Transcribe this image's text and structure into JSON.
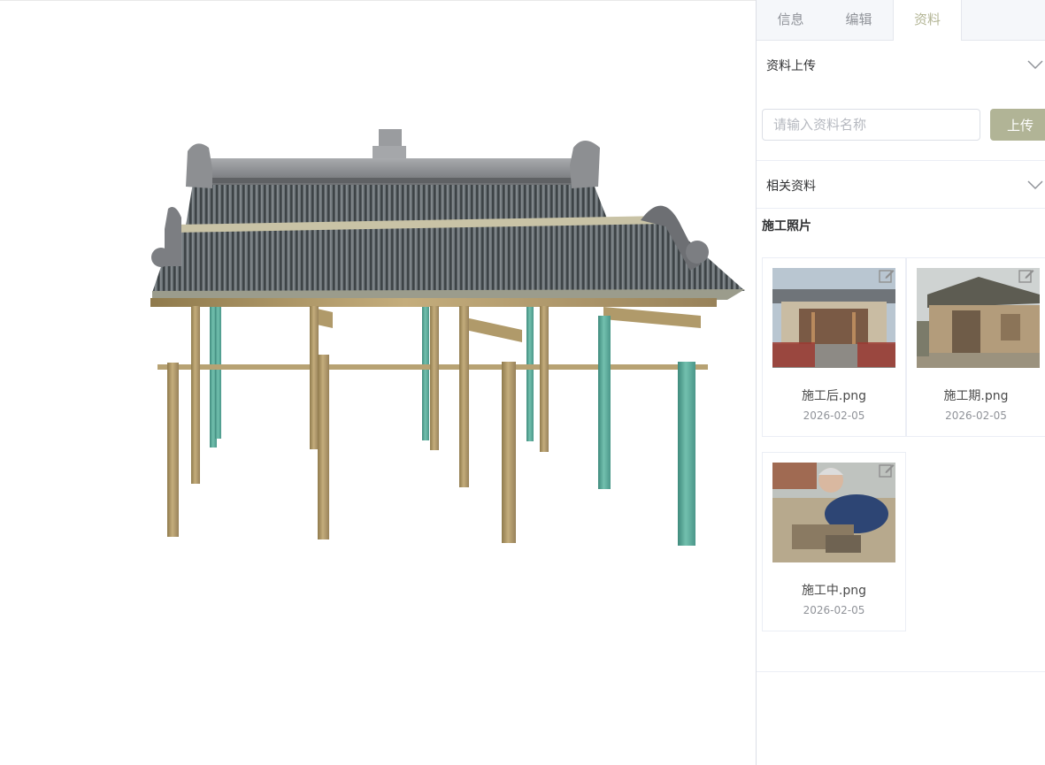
{
  "tabs": [
    {
      "label": "信息"
    },
    {
      "label": "编辑"
    },
    {
      "label": "资料"
    }
  ],
  "active_tab": "资料",
  "upload_section": {
    "title": "资料上传",
    "input_placeholder": "请输入资料名称",
    "input_value": "",
    "button_label": "上传"
  },
  "related_section": {
    "title": "相关资料",
    "group_title": "施工照片",
    "files": [
      {
        "name": "施工后.png",
        "date": "2026-02-05"
      },
      {
        "name": "施工期.png",
        "date": "2026-02-05"
      },
      {
        "name": "施工中.png",
        "date": "2026-02-05"
      }
    ]
  },
  "icons": {
    "collapse": "chevron-down-icon",
    "edit": "edit-icon"
  },
  "colors": {
    "accent": "#b1b496",
    "active_tab_text": "#b3b595",
    "roof_tile": "#4e5559",
    "ridge": "#8d8f92",
    "wood_post": "#b09a6a",
    "green_post": "#5fab9b"
  }
}
